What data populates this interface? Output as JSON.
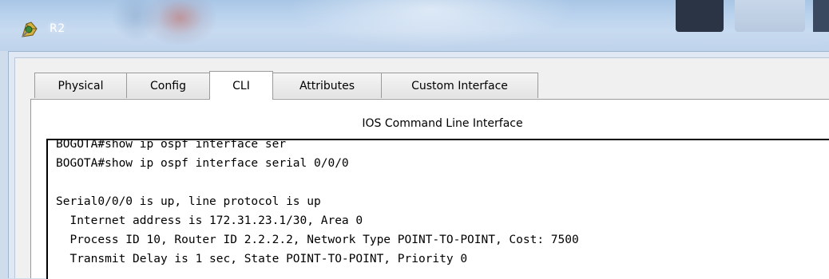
{
  "window": {
    "title": "R2",
    "app_icon": "packet-tracer-router-icon"
  },
  "tabs": [
    {
      "label": "Physical",
      "active": false
    },
    {
      "label": "Config",
      "active": false
    },
    {
      "label": "CLI",
      "active": true
    },
    {
      "label": "Attributes",
      "active": false
    },
    {
      "label": "Custom Interface",
      "active": false
    }
  ],
  "panel": {
    "title": "IOS Command Line Interface"
  },
  "console": {
    "lines": [
      "BOGOTA#show ip ospf interface ser",
      "BOGOTA#show ip ospf interface serial 0/0/0",
      "",
      "Serial0/0/0 is up, line protocol is up",
      "  Internet address is 172.31.23.1/30, Area 0",
      "  Process ID 10, Router ID 2.2.2.2, Network Type POINT-TO-POINT, Cost: 7500",
      "  Transmit Delay is 1 sec, State POINT-TO-POINT, Priority 0"
    ]
  },
  "colors": {
    "titlebar": "#bcd4ee",
    "console_bg": "#ffffff",
    "console_text": "#000000"
  }
}
